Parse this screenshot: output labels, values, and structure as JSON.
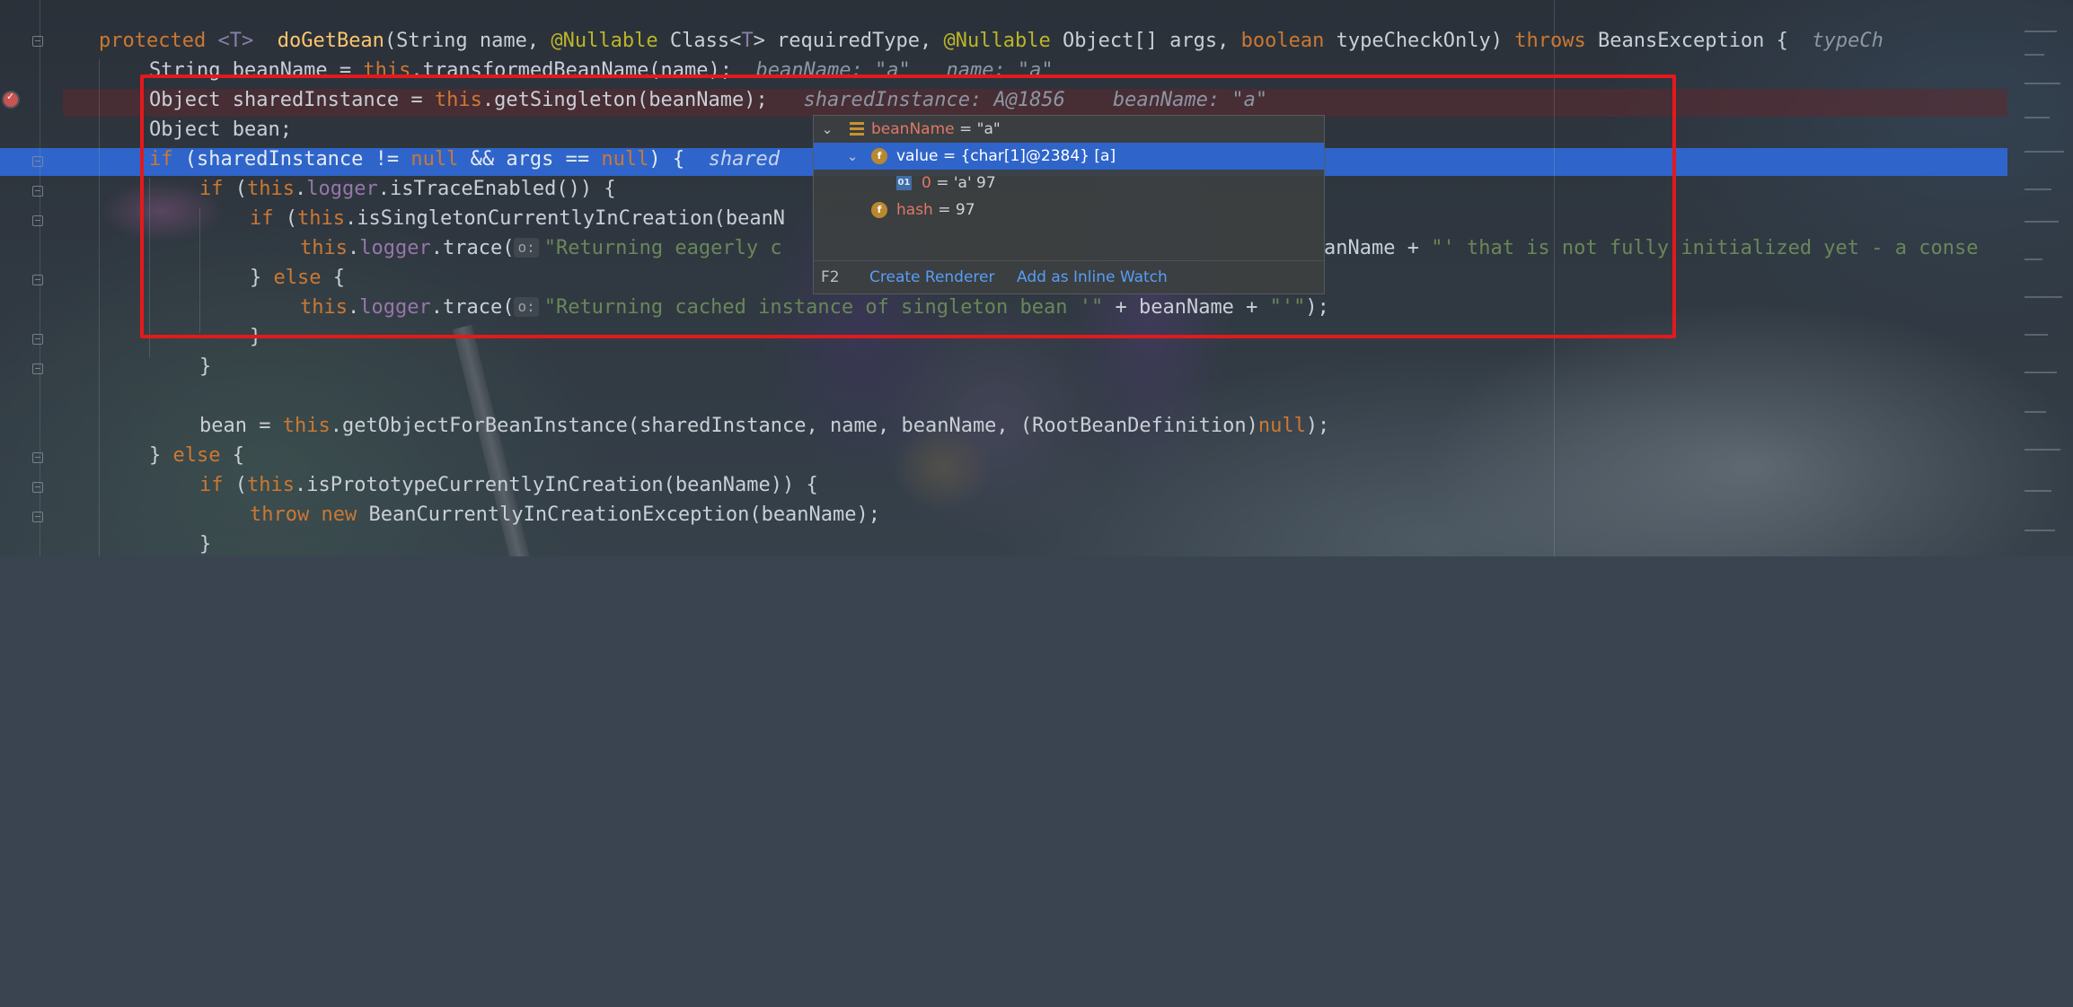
{
  "code": {
    "line1": {
      "kw": "protected",
      "gen": "<T>",
      "method": "doGetBean",
      "p1": "(String name, ",
      "ann1": "@Nullable",
      "p2": " Class<",
      "gen2": "T",
      "p3": "> requiredType, ",
      "ann2": "@Nullable",
      "p4": " Object[] args, ",
      "kw2": "boolean",
      "p5": " typeCheckOnly) ",
      "kw3": "throws",
      "p6": " BeansException {",
      "hint": "typeCh"
    },
    "line2": {
      "a": "String beanName = ",
      "kw": "this",
      "b": ".transformedBeanName(name);",
      "hint": "beanName: \"a\"   name: \"a\""
    },
    "line3": {
      "a": "Object sharedInstance = ",
      "kw": "this",
      "b": ".getSingleton(beanName);",
      "hint1": "sharedInstance: A@1856",
      "hint2": "beanName: \"a\""
    },
    "line4": {
      "a": "Object bean;"
    },
    "line5": {
      "kw": "if",
      "a": " (sharedInstance != ",
      "kw2": "null",
      "b": " && args == ",
      "kw3": "null",
      "c": ") {",
      "hint": "shared"
    },
    "line6": {
      "kw": "if",
      "a": " (",
      "kw2": "this",
      "b": ".",
      "fld": "logger",
      "c": ".isTraceEnabled()) {"
    },
    "line7": {
      "kw": "if",
      "a": " (",
      "kw2": "this",
      "b": ".isSingletonCurrentlyInCreation(beanN"
    },
    "line8": {
      "kw": "this",
      "a": ".",
      "fld": "logger",
      "b": ".trace(",
      "param": "o:",
      "str": "\"Returning eagerly c",
      "c": "anName + ",
      "str2": "\"' that is not fully initialized yet - a conse"
    },
    "line9": {
      "a": "} ",
      "kw": "else",
      "b": " {"
    },
    "line10": {
      "kw": "this",
      "a": ".",
      "fld": "logger",
      "b": ".trace(",
      "param": "o:",
      "str": "\"Returning cached instance of singleton bean '\"",
      "c": " + beanName + ",
      "str2": "\"'\"",
      "d": ");"
    },
    "line11": {
      "a": "}"
    },
    "line12": {
      "a": "}"
    },
    "line14": {
      "a": "bean = ",
      "kw": "this",
      "b": ".getObjectForBeanInstance(sharedInstance, name, beanName, (RootBeanDefinition)",
      "kw2": "null",
      "c": ");"
    },
    "line15": {
      "a": "} ",
      "kw": "else",
      "b": " {"
    },
    "line16": {
      "kw": "if",
      "a": " (",
      "kw2": "this",
      "b": ".isPrototypeCurrentlyInCreation(beanName)) {"
    },
    "line17": {
      "kw": "throw",
      "a": " ",
      "kw2": "new",
      "b": " BeanCurrentlyInCreationException(beanName);"
    },
    "line18": {
      "a": "}"
    }
  },
  "popup": {
    "row1": {
      "name": "beanName",
      "value": " = \"a\""
    },
    "row2": {
      "name": "value",
      "value": " = {char[1]@2384} [a]"
    },
    "row3": {
      "name": "0",
      "value": " = 'a' 97",
      "icon": "01"
    },
    "row4": {
      "name": "hash",
      "value": " = 97"
    },
    "footer": {
      "key": "F2",
      "create_renderer": "Create Renderer",
      "add_watch": "Add as Inline Watch"
    }
  },
  "colors": {
    "keyword": "#cc7832",
    "method": "#ffc66d",
    "annotation": "#bbb529",
    "field": "#9876aa",
    "string": "#6a8759",
    "exec_line": "#2f65ca",
    "breakpoint": "#c75450",
    "highlight_box": "#e4191c"
  }
}
